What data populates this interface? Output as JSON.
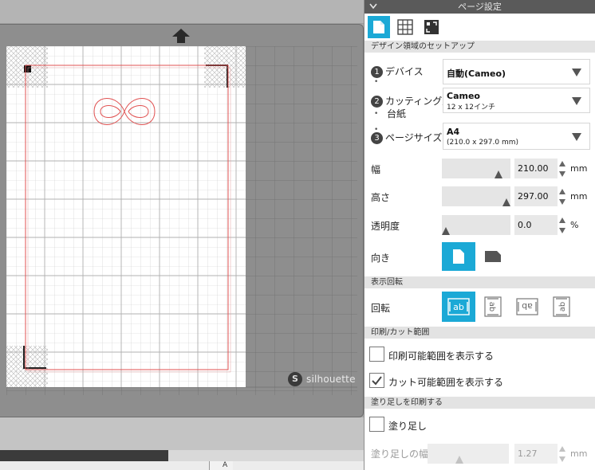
{
  "panel": {
    "title": "ページ設定",
    "sections": {
      "design_setup": "デザイン領域のセットアップ",
      "rotation": "表示回転",
      "print_cut": "印刷/カット範囲",
      "bleed": "塗り足しを印刷する"
    },
    "device": {
      "label": "デバイス",
      "value": "自動(Cameo)"
    },
    "cutting_mat": {
      "label_line1": "カッティング用",
      "label_line2": "台紙",
      "value": "Cameo",
      "sub": "12 x 12インチ"
    },
    "page_size": {
      "label": "ページサイズ",
      "value": "A4",
      "sub": "(210.0 x 297.0 mm)"
    },
    "width": {
      "label": "幅",
      "value": "210.00",
      "unit": "mm",
      "slider_fraction": 0.98
    },
    "height": {
      "label": "高さ",
      "value": "297.00",
      "unit": "mm",
      "slider_fraction": 0.99
    },
    "transparency": {
      "label": "透明度",
      "value": "0.0",
      "unit": "%",
      "slider_fraction": 0.0
    },
    "orientation": {
      "label": "向き"
    },
    "rotate": {
      "label": "回転"
    },
    "show_print_area": {
      "label": "印刷可能範囲を表示する",
      "checked": false
    },
    "show_cut_area": {
      "label": "カット可能範囲を表示する",
      "checked": true
    },
    "bleed_check": {
      "label": "塗り足し",
      "checked": false
    },
    "bleed_width": {
      "label": "塗り足しの幅",
      "value": "1.27",
      "unit": "mm"
    },
    "step_numbers": [
      "1",
      "2",
      "3"
    ]
  },
  "canvas": {
    "logo_mark": "S",
    "logo_text": "silhouette",
    "tool_peek": "A"
  },
  "colors": {
    "accent": "#1ba9d6",
    "header": "#5a5a5a",
    "section": "#e3e3e3",
    "cut_line": "#e05050"
  }
}
